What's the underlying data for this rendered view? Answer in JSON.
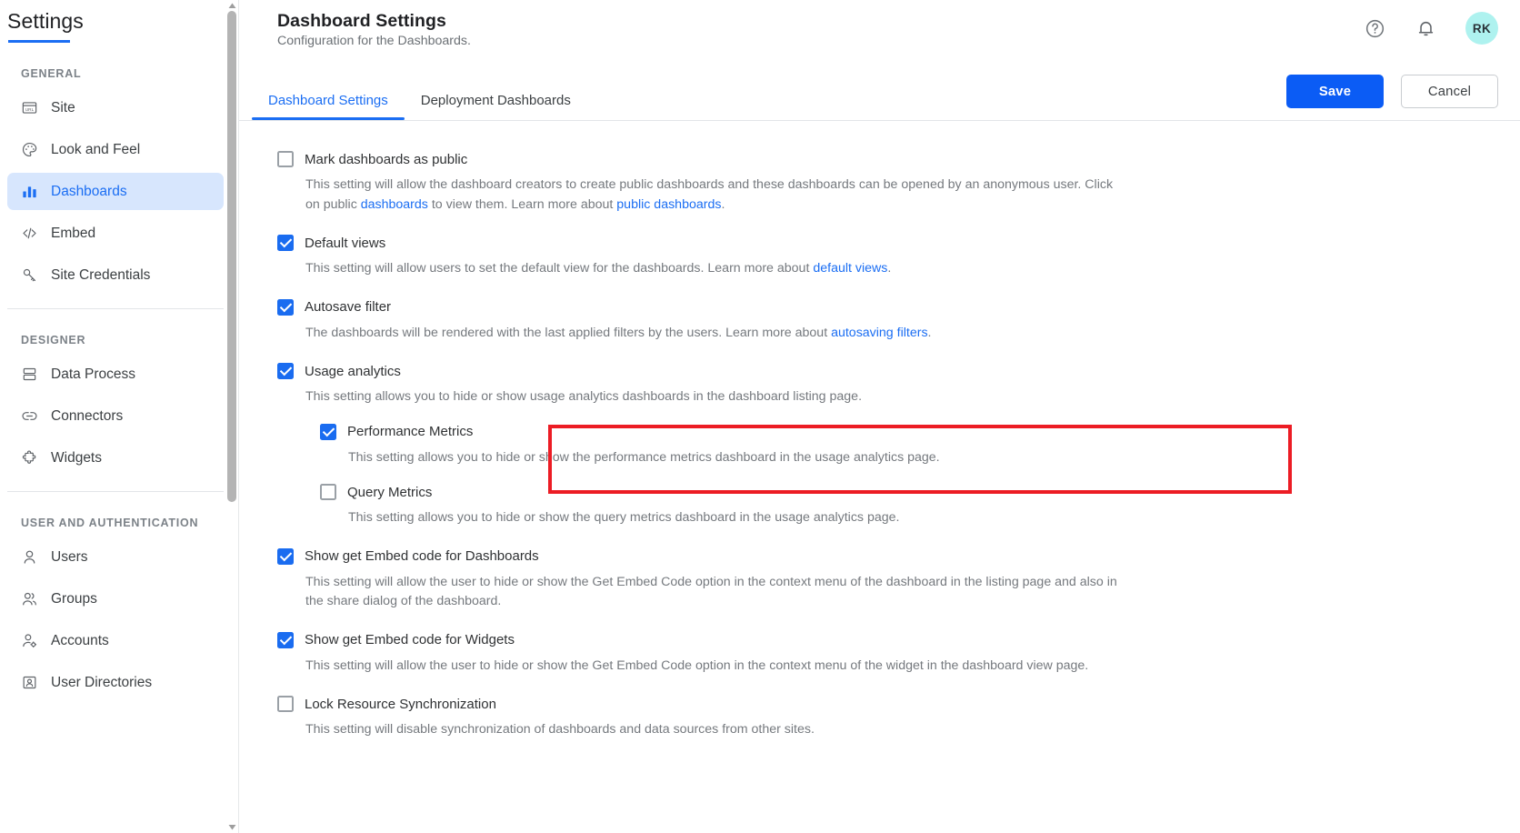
{
  "sidebar": {
    "title": "Settings",
    "sections": [
      {
        "label": "GENERAL",
        "items": [
          {
            "label": "Site",
            "icon": "url-window-icon",
            "active": false
          },
          {
            "label": "Look and Feel",
            "icon": "palette-icon",
            "active": false
          },
          {
            "label": "Dashboards",
            "icon": "bar-chart-icon",
            "active": true
          },
          {
            "label": "Embed",
            "icon": "code-brackets-icon",
            "active": false
          },
          {
            "label": "Site Credentials",
            "icon": "key-icon",
            "active": false
          }
        ]
      },
      {
        "label": "DESIGNER",
        "items": [
          {
            "label": "Data Process",
            "icon": "stacked-rows-icon",
            "active": false
          },
          {
            "label": "Connectors",
            "icon": "link-icon",
            "active": false
          },
          {
            "label": "Widgets",
            "icon": "puzzle-icon",
            "active": false
          }
        ]
      },
      {
        "label": "USER AND AUTHENTICATION",
        "items": [
          {
            "label": "Users",
            "icon": "user-icon",
            "active": false
          },
          {
            "label": "Groups",
            "icon": "users-group-icon",
            "active": false
          },
          {
            "label": "Accounts",
            "icon": "user-gear-icon",
            "active": false
          },
          {
            "label": "User Directories",
            "icon": "id-card-icon",
            "active": false
          }
        ]
      }
    ]
  },
  "header": {
    "title": "Dashboard Settings",
    "subtitle": "Configuration for the Dashboards.",
    "help_icon": "help-circle-icon",
    "notification_icon": "bell-icon",
    "avatar_initials": "RK"
  },
  "actions": {
    "save_label": "Save",
    "cancel_label": "Cancel"
  },
  "tabs": [
    {
      "label": "Dashboard Settings",
      "active": true
    },
    {
      "label": "Deployment Dashboards",
      "active": false
    }
  ],
  "settings": [
    {
      "label": "Mark dashboards as public",
      "checked": false,
      "desc_parts": [
        {
          "t": "This setting will allow the dashboard creators to create public dashboards and these dashboards can be opened by an anonymous user. Click on public ",
          "link": false
        },
        {
          "t": "dashboards",
          "link": true
        },
        {
          "t": " to view them. Learn more about ",
          "link": false
        },
        {
          "t": "public dashboards",
          "link": true
        },
        {
          "t": ".",
          "link": false
        }
      ]
    },
    {
      "label": "Default views",
      "checked": true,
      "desc_parts": [
        {
          "t": "This setting will allow users to set the default view for the dashboards. Learn more about ",
          "link": false
        },
        {
          "t": "default views",
          "link": true
        },
        {
          "t": ".",
          "link": false
        }
      ]
    },
    {
      "label": "Autosave filter",
      "checked": true,
      "desc_parts": [
        {
          "t": "The dashboards will be rendered with the last applied filters by the users. Learn more about ",
          "link": false
        },
        {
          "t": "autosaving filters",
          "link": true
        },
        {
          "t": ".",
          "link": false
        }
      ]
    },
    {
      "label": "Usage analytics",
      "checked": true,
      "desc_parts": [
        {
          "t": "This setting allows you to hide or show usage analytics dashboards in the dashboard listing page.",
          "link": false
        }
      ],
      "children": [
        {
          "label": "Performance Metrics",
          "checked": true,
          "highlighted": true,
          "desc_parts": [
            {
              "t": "This setting allows you to hide or show the performance metrics dashboard in the usage analytics page.",
              "link": false
            }
          ]
        },
        {
          "label": "Query Metrics",
          "checked": false,
          "highlighted": false,
          "desc_parts": [
            {
              "t": "This setting allows you to hide or show the query metrics dashboard in the usage analytics page.",
              "link": false
            }
          ]
        }
      ]
    },
    {
      "label": "Show get Embed code for Dashboards",
      "checked": true,
      "desc_parts": [
        {
          "t": "This setting will allow the user to hide or show the Get Embed Code option in the context menu of the dashboard in the listing page and also in the share dialog of the dashboard.",
          "link": false
        }
      ]
    },
    {
      "label": "Show get Embed code for Widgets",
      "checked": true,
      "desc_parts": [
        {
          "t": "This setting will allow the user to hide or show the Get Embed Code option in the context menu of the widget in the dashboard view page.",
          "link": false
        }
      ]
    },
    {
      "label": "Lock Resource Synchronization",
      "checked": false,
      "desc_parts": [
        {
          "t": "This setting will disable synchronization of dashboards and data sources from other sites.",
          "link": false
        }
      ]
    }
  ],
  "colors": {
    "accent": "#1b6ef3",
    "save_button": "#0b5cf5",
    "active_nav_bg": "#d7e6fd",
    "highlight_border": "#ec1c24",
    "avatar_bg": "#aef2ef"
  }
}
